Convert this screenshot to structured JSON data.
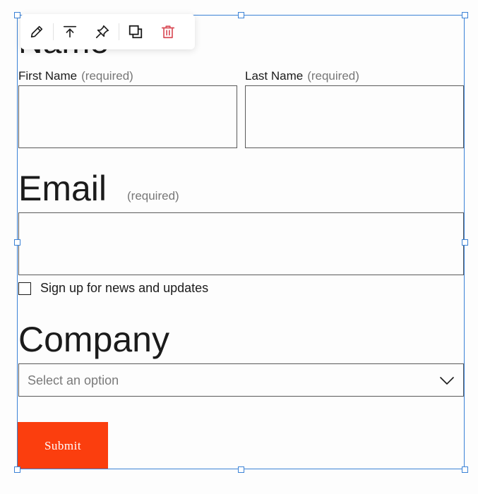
{
  "form": {
    "name_heading": "Name",
    "first_name": {
      "label": "First Name",
      "required": "(required)"
    },
    "last_name": {
      "label": "Last Name",
      "required": "(required)"
    },
    "email": {
      "heading": "Email",
      "required": "(required)"
    },
    "newsletter": {
      "label": "Sign up for news and updates",
      "checked": false
    },
    "company": {
      "heading": "Company",
      "placeholder": "Select an option"
    },
    "submit_label": "Submit"
  },
  "toolbar": {
    "items": [
      "pencil-icon",
      "move-to-top-icon",
      "pin-icon",
      "duplicate-icon",
      "trash-icon"
    ]
  },
  "colors": {
    "selection": "#3b82d6",
    "submit_bg": "#fb3e0e",
    "delete_icon": "#d94b56",
    "text": "#1b1b1b",
    "muted": "#777777"
  }
}
